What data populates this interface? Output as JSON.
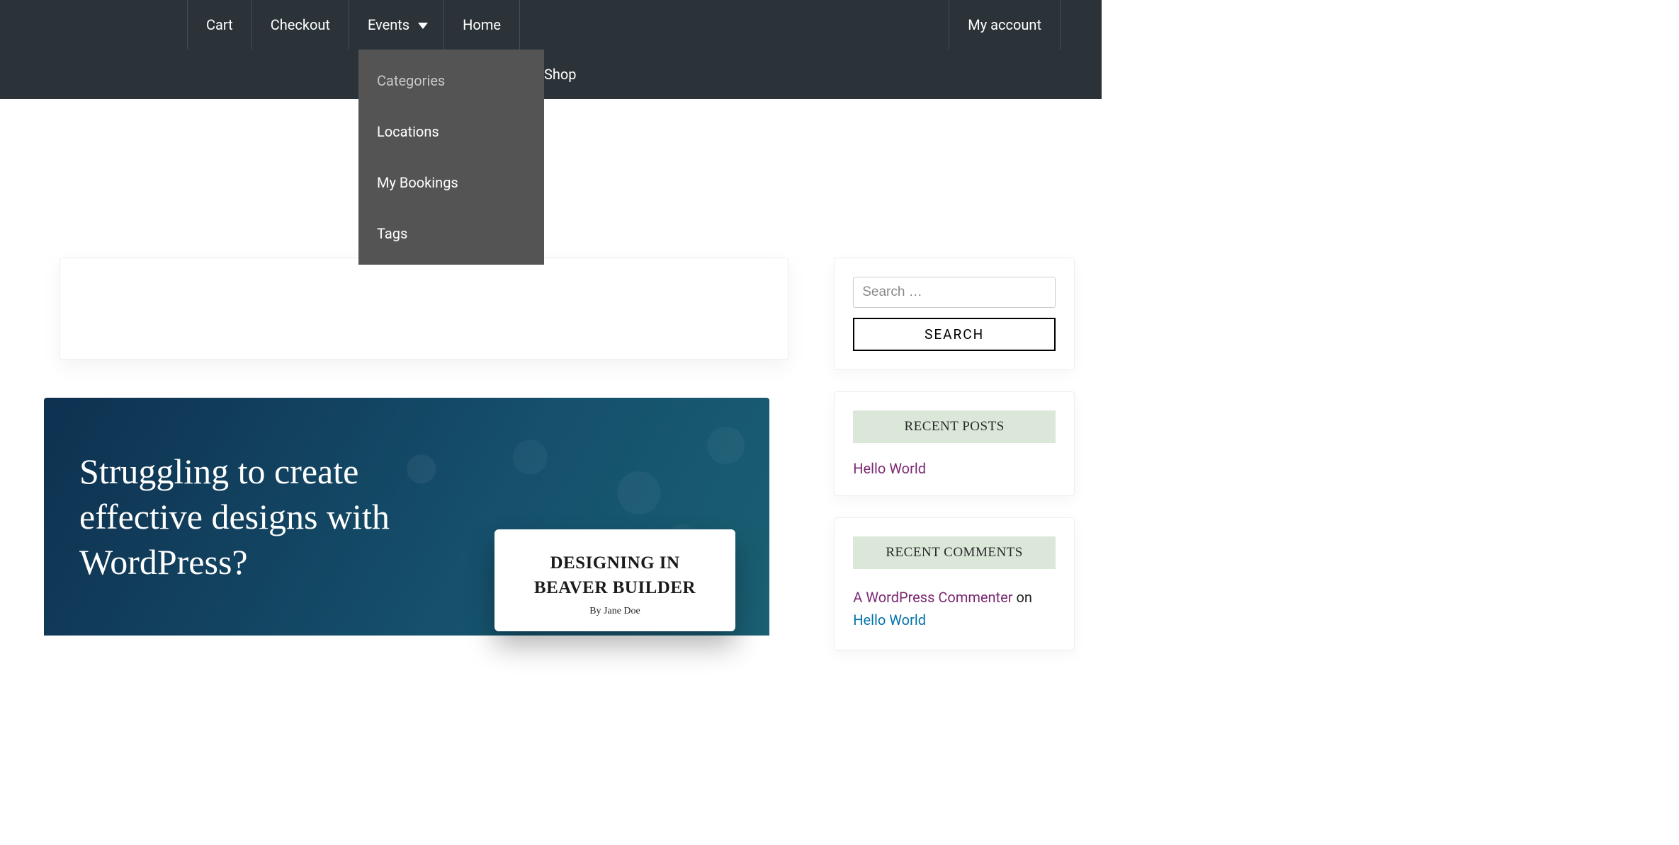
{
  "nav": {
    "items": [
      "Cart",
      "Checkout",
      "Events",
      "Home"
    ],
    "right": "My account",
    "row2_shop": "Shop"
  },
  "dropdown": {
    "items": [
      "Categories",
      "Locations",
      "My Bookings",
      "Tags"
    ]
  },
  "hero": {
    "title": "Struggling to create effective designs with WordPress?",
    "card_title": "DESIGNING IN BEAVER BUILDER",
    "card_byline": "By Jane Doe"
  },
  "sidebar": {
    "search_placeholder": "Search …",
    "search_button": "SEARCH",
    "recent_posts_header": "RECENT POSTS",
    "recent_posts": [
      "Hello World"
    ],
    "recent_comments_header": "RECENT COMMENTS",
    "comment_author": "A WordPress Commenter",
    "comment_on": " on ",
    "comment_post": "Hello World"
  }
}
